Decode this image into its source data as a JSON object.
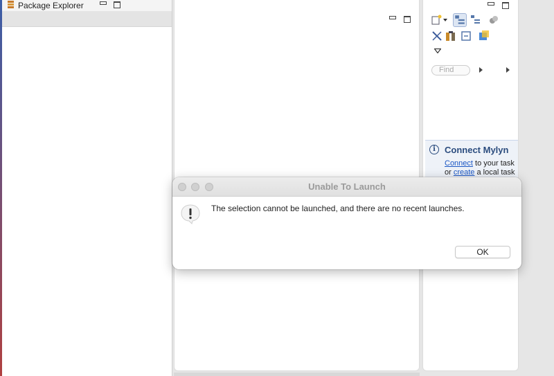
{
  "package_explorer": {
    "title": "Package Explorer"
  },
  "task_panel": {
    "find_placeholder": "Find"
  },
  "mylyn": {
    "title": "Connect Mylyn",
    "connect_link": "Connect",
    "line1_rest": " to your task",
    "or_text": "or ",
    "create_link": "create",
    "line2_rest": " a local task"
  },
  "dialog": {
    "title": "Unable To Launch",
    "message": "The selection cannot be launched, and there are no recent launches.",
    "ok_label": "OK"
  },
  "icons": {
    "alert": "exclamation-alert-icon",
    "info": "info-icon"
  },
  "colors": {
    "link": "#1a56c4",
    "mylyn_title": "#2b4c7e",
    "dialog_title": "#9a9a9a"
  }
}
